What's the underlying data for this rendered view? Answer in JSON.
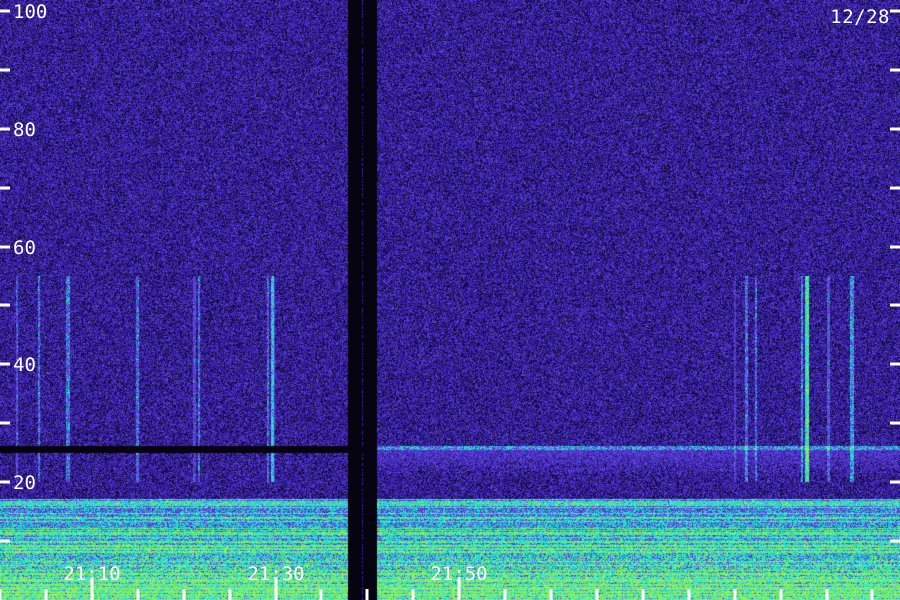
{
  "date_label": "12/28",
  "colors": {
    "background": "#2a1570",
    "noise_dark": "#120a40",
    "noise_mid": "#3a22a8",
    "noise_light": "#5a44d8",
    "band_cyan": "#25d6d0",
    "band_green": "#8cf060",
    "gap_line": "#05030f",
    "tick": "#ffffff",
    "text": "#ffffff"
  },
  "chart_data": {
    "type": "heatmap",
    "title": "",
    "xlabel": "",
    "ylabel": "",
    "y_axis": {
      "ylim": [
        0,
        110
      ],
      "major_ticks": [
        20,
        40,
        60,
        80,
        100
      ],
      "minor_ticks": [
        10,
        30,
        50,
        70,
        90
      ],
      "tick_labels": [
        "20",
        "40",
        "60",
        "80",
        "100"
      ]
    },
    "x_axis": {
      "range_minutes": [
        21.0,
        21.98
      ],
      "label_ticks": [
        {
          "value": 21.1,
          "label": "21:10"
        },
        {
          "value": 21.3,
          "label": "21:30"
        },
        {
          "value": 21.5,
          "label": "21:50"
        }
      ],
      "minor_tick_step_min": 5
    },
    "data_gaps": [
      {
        "type": "vertical",
        "from": 21.38,
        "to": 21.41
      },
      {
        "type": "horizontal",
        "from": 21.0,
        "to": 21.41,
        "y": 25.5
      }
    ],
    "features": [
      {
        "name": "low-frequency emission",
        "y_range": [
          0,
          17
        ]
      },
      {
        "name": "noise band edge",
        "y_range": [
          21,
          26
        ],
        "x_range": [
          21.4,
          21.98
        ]
      },
      {
        "name": "vertical streaks",
        "y_range": [
          20,
          55
        ],
        "x_range": [
          21.0,
          21.3
        ]
      },
      {
        "name": "vertical streaks",
        "y_range": [
          20,
          55
        ],
        "x_range": [
          21.74,
          21.98
        ]
      }
    ]
  }
}
